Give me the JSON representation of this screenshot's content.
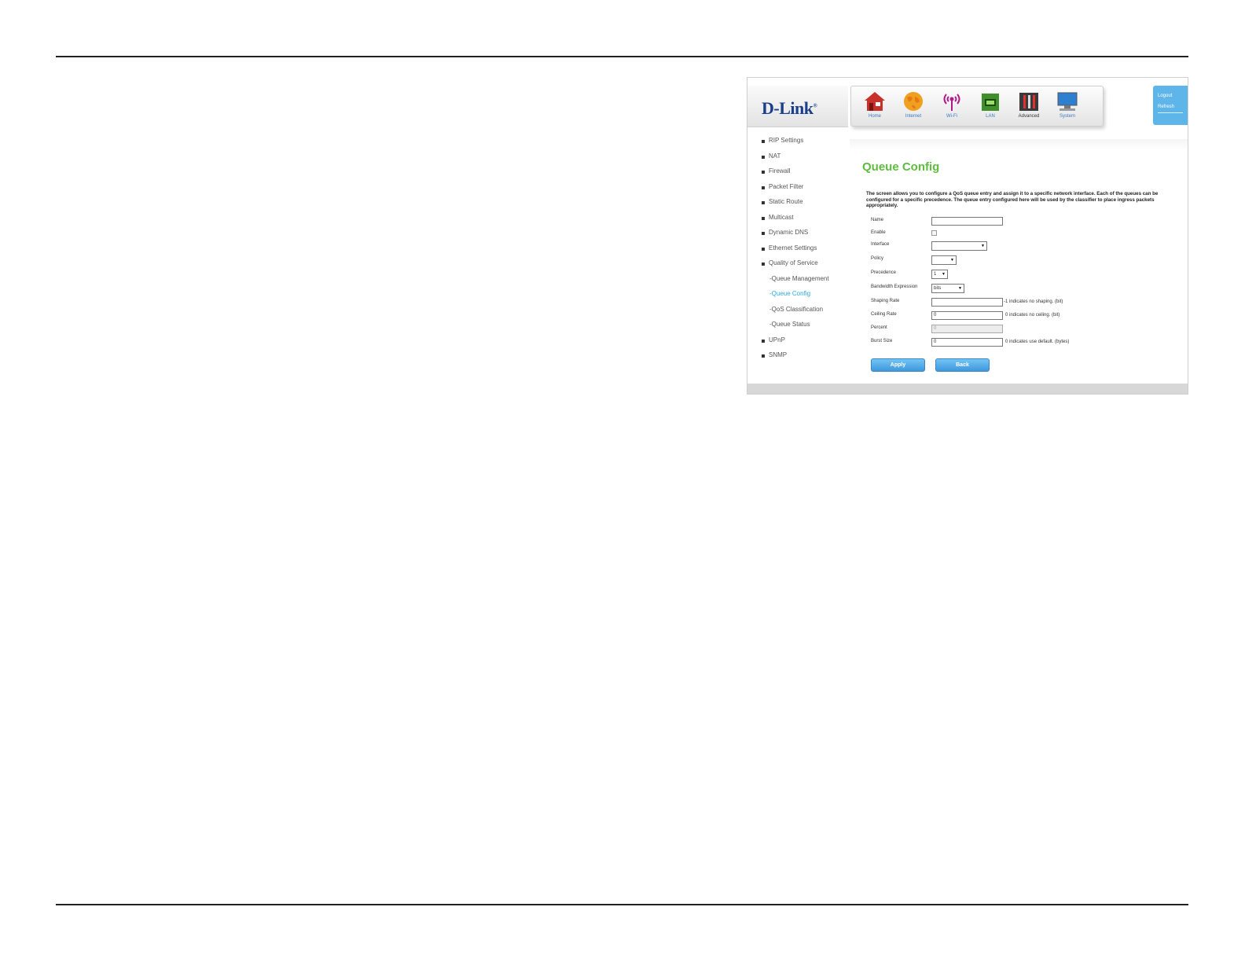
{
  "header": {
    "logo_text": "D-Link",
    "logo_mark": "®",
    "nav": [
      {
        "label": "Home",
        "icon": "home-icon"
      },
      {
        "label": "Internet",
        "icon": "globe-icon"
      },
      {
        "label": "Wi-Fi",
        "icon": "wifi-icon"
      },
      {
        "label": "LAN",
        "icon": "lan-icon"
      },
      {
        "label": "Advanced",
        "icon": "tools-icon"
      },
      {
        "label": "System",
        "icon": "monitor-icon"
      }
    ],
    "logout": "Logout",
    "refresh": "Refresh"
  },
  "sidebar": {
    "items": [
      {
        "label": "RIP Settings"
      },
      {
        "label": "NAT"
      },
      {
        "label": "Firewall"
      },
      {
        "label": "Packet Filter"
      },
      {
        "label": "Static Route"
      },
      {
        "label": "Multicast"
      },
      {
        "label": "Dynamic DNS"
      },
      {
        "label": "Ethernet Settings"
      },
      {
        "label": "Quality of Service"
      },
      {
        "label": "-Queue Management"
      },
      {
        "label": "-Queue Config"
      },
      {
        "label": "-QoS Classification"
      },
      {
        "label": "-Queue Status"
      },
      {
        "label": "UPnP"
      },
      {
        "label": "SNMP"
      }
    ],
    "active": "-Queue Config"
  },
  "main": {
    "title": "Queue Config",
    "description": "The screen allows you to configure a QoS queue entry and assign it to a specific network interface. Each of the queues can be configured for a specific precedence. The queue entry configured here will be used by the classifier to place ingress packets appropriately.",
    "form": {
      "name_label": "Name",
      "name_value": "",
      "enable_label": "Enable",
      "interface_label": "Interface",
      "interface_value": "",
      "policy_label": "Policy",
      "policy_value": "",
      "precedence_label": "Precedence",
      "precedence_value": "1",
      "bandwidth_label": "Bandwidth Expression",
      "bandwidth_value": "bits",
      "shaping_label": "Shaping Rate",
      "shaping_value": "",
      "shaping_hint": "-1 indicates no shaping. (bit)",
      "ceiling_label": "Ceiling Rate",
      "ceiling_value": "0",
      "ceiling_hint": "0 indicates no ceiling. (bit)",
      "percent_label": "Percent",
      "percent_value": "0",
      "burst_label": "Burst Size",
      "burst_value": "0",
      "burst_hint": "0 indicates use default. (bytes)"
    },
    "apply_label": "Apply",
    "back_label": "Back"
  },
  "colors": {
    "title_green": "#5ebd3e",
    "active_blue": "#2fa7e0",
    "button_blue": "#4aa3e2",
    "logo_blue": "#1a3f8a"
  }
}
